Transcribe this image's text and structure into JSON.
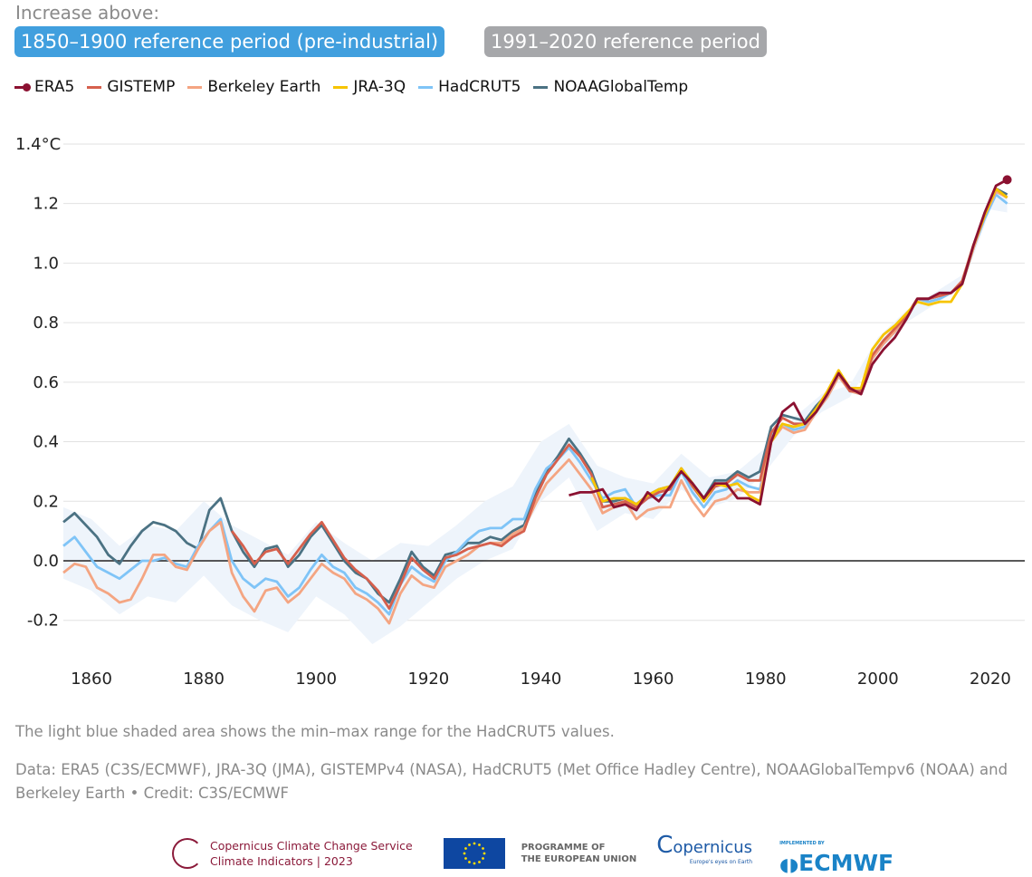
{
  "header": {
    "intro": "Increase above:",
    "reference_buttons": [
      {
        "label": "1850–1900 reference period (pre-industrial)",
        "selected": true,
        "color": "#419fde"
      },
      {
        "label": "1991–2020 reference period",
        "selected": false,
        "color": "#a6a7aa"
      }
    ]
  },
  "legend": [
    {
      "name": "ERA5",
      "color": "#8b1131"
    },
    {
      "name": "GISTEMP",
      "color": "#d6604d"
    },
    {
      "name": "Berkeley Earth",
      "color": "#f4a582"
    },
    {
      "name": "JRA-3Q",
      "color": "#f7c400"
    },
    {
      "name": "HadCRUT5",
      "color": "#7fc4f7"
    },
    {
      "name": "NOAAGlobalTemp",
      "color": "#4b7283"
    }
  ],
  "chart_data": {
    "type": "line",
    "title": "",
    "xlabel": "",
    "ylabel": "",
    "y_unit": "°C",
    "xlim": [
      1855,
      2024
    ],
    "ylim": [
      -0.3,
      1.45
    ],
    "yticks": [
      -0.2,
      0.0,
      0.2,
      0.4,
      0.6,
      0.8,
      1.0,
      1.2,
      1.4
    ],
    "ytick_labels": [
      "-0.2",
      "0.0",
      "0.2",
      "0.4",
      "0.6",
      "0.8",
      "1.0",
      "1.2",
      "1.4°C"
    ],
    "xticks": [
      1860,
      1880,
      1900,
      1920,
      1940,
      1960,
      1980,
      2000,
      2020
    ],
    "xtick_labels": [
      "1860",
      "1880",
      "1900",
      "1920",
      "1940",
      "1960",
      "1980",
      "2000",
      "2020"
    ],
    "grid": "horizontal",
    "zero_line": true,
    "x": [
      1855,
      1857,
      1859,
      1861,
      1863,
      1865,
      1867,
      1869,
      1871,
      1873,
      1875,
      1877,
      1879,
      1881,
      1883,
      1885,
      1887,
      1889,
      1891,
      1893,
      1895,
      1897,
      1899,
      1901,
      1903,
      1905,
      1907,
      1909,
      1911,
      1913,
      1915,
      1917,
      1919,
      1921,
      1923,
      1925,
      1927,
      1929,
      1931,
      1933,
      1935,
      1937,
      1939,
      1941,
      1943,
      1945,
      1947,
      1949,
      1951,
      1953,
      1955,
      1957,
      1959,
      1961,
      1963,
      1965,
      1967,
      1969,
      1971,
      1973,
      1975,
      1977,
      1979,
      1981,
      1983,
      1985,
      1987,
      1989,
      1991,
      1993,
      1995,
      1997,
      1999,
      2001,
      2003,
      2005,
      2007,
      2009,
      2011,
      2013,
      2015,
      2017,
      2019,
      2021,
      2023
    ],
    "series": [
      {
        "name": "NOAAGlobalTemp",
        "color": "#4b7283",
        "values": [
          0.13,
          0.16,
          0.12,
          0.08,
          0.02,
          -0.01,
          0.05,
          0.1,
          0.13,
          0.12,
          0.1,
          0.06,
          0.04,
          0.17,
          0.21,
          0.1,
          0.03,
          -0.02,
          0.04,
          0.05,
          -0.02,
          0.02,
          0.08,
          0.12,
          0.06,
          0.0,
          -0.04,
          -0.06,
          -0.11,
          -0.14,
          -0.06,
          0.03,
          -0.02,
          -0.05,
          0.02,
          0.03,
          0.06,
          0.06,
          0.08,
          0.07,
          0.1,
          0.12,
          0.22,
          0.3,
          0.35,
          0.41,
          0.36,
          0.3,
          0.2,
          0.2,
          0.21,
          0.19,
          0.22,
          0.24,
          0.25,
          0.31,
          0.26,
          0.21,
          0.27,
          0.27,
          0.3,
          0.28,
          0.3,
          0.45,
          0.49,
          0.48,
          0.47,
          0.52,
          0.56,
          0.63,
          0.57,
          0.57,
          0.68,
          0.73,
          0.77,
          0.82,
          0.88,
          0.88,
          0.89,
          0.9,
          0.93,
          1.05,
          1.16,
          1.25,
          1.23
        ]
      },
      {
        "name": "HadCRUT5",
        "color": "#7fc4f7",
        "values": [
          0.05,
          0.08,
          0.03,
          -0.02,
          -0.04,
          -0.06,
          -0.03,
          0.0,
          0.0,
          0.01,
          -0.01,
          -0.02,
          0.05,
          0.1,
          0.14,
          0.0,
          -0.06,
          -0.09,
          -0.06,
          -0.07,
          -0.12,
          -0.09,
          -0.03,
          0.02,
          -0.02,
          -0.04,
          -0.09,
          -0.11,
          -0.14,
          -0.18,
          -0.08,
          -0.02,
          -0.05,
          -0.07,
          0.0,
          0.03,
          0.07,
          0.1,
          0.11,
          0.11,
          0.14,
          0.14,
          0.24,
          0.31,
          0.34,
          0.38,
          0.33,
          0.27,
          0.21,
          0.23,
          0.24,
          0.18,
          0.21,
          0.22,
          0.22,
          0.3,
          0.23,
          0.18,
          0.23,
          0.24,
          0.27,
          0.25,
          0.24,
          0.42,
          0.46,
          0.44,
          0.45,
          0.5,
          0.55,
          0.62,
          0.57,
          0.56,
          0.68,
          0.73,
          0.77,
          0.82,
          0.88,
          0.87,
          0.88,
          0.9,
          0.93,
          1.05,
          1.15,
          1.23,
          1.2
        ]
      },
      {
        "name": "Berkeley Earth",
        "color": "#f4a582",
        "values": [
          -0.04,
          -0.01,
          -0.02,
          -0.09,
          -0.11,
          -0.14,
          -0.13,
          -0.06,
          0.02,
          0.02,
          -0.02,
          -0.03,
          0.04,
          0.1,
          0.13,
          -0.04,
          -0.12,
          -0.17,
          -0.1,
          -0.09,
          -0.14,
          -0.11,
          -0.06,
          -0.01,
          -0.04,
          -0.06,
          -0.11,
          -0.13,
          -0.16,
          -0.21,
          -0.11,
          -0.05,
          -0.08,
          -0.09,
          -0.02,
          0.0,
          0.02,
          0.05,
          0.06,
          0.06,
          0.09,
          0.11,
          0.19,
          0.26,
          0.3,
          0.34,
          0.29,
          0.24,
          0.16,
          0.18,
          0.2,
          0.14,
          0.17,
          0.18,
          0.18,
          0.27,
          0.2,
          0.15,
          0.2,
          0.21,
          0.24,
          0.23,
          0.23,
          0.4,
          0.45,
          0.43,
          0.44,
          0.5,
          0.55,
          0.62,
          0.57,
          0.56,
          0.68,
          0.73,
          0.77,
          0.82,
          0.88,
          0.88,
          0.89,
          0.9,
          0.93,
          1.05,
          1.16,
          1.24,
          1.22
        ]
      },
      {
        "name": "GISTEMP",
        "color": "#d6604d",
        "values": [
          null,
          null,
          null,
          null,
          null,
          null,
          null,
          null,
          null,
          null,
          null,
          null,
          null,
          null,
          null,
          0.1,
          0.05,
          -0.01,
          0.03,
          0.04,
          -0.01,
          0.04,
          0.09,
          0.13,
          0.07,
          0.01,
          -0.03,
          -0.06,
          -0.1,
          -0.16,
          -0.08,
          0.01,
          -0.03,
          -0.06,
          0.01,
          0.02,
          0.04,
          0.05,
          0.06,
          0.05,
          0.08,
          0.1,
          0.21,
          0.29,
          0.34,
          0.39,
          0.35,
          0.29,
          0.18,
          0.19,
          0.2,
          0.18,
          0.21,
          0.23,
          0.24,
          0.31,
          0.25,
          0.2,
          0.25,
          0.26,
          0.29,
          0.27,
          0.27,
          0.43,
          0.48,
          0.46,
          0.46,
          0.51,
          0.56,
          0.63,
          0.57,
          0.57,
          0.69,
          0.74,
          0.78,
          0.82,
          0.88,
          0.88,
          0.89,
          0.9,
          0.94,
          1.06,
          1.16,
          1.25,
          1.22
        ]
      },
      {
        "name": "JRA-3Q",
        "color": "#f7c400",
        "values": [
          null,
          null,
          null,
          null,
          null,
          null,
          null,
          null,
          null,
          null,
          null,
          null,
          null,
          null,
          null,
          null,
          null,
          null,
          null,
          null,
          null,
          null,
          null,
          null,
          null,
          null,
          null,
          null,
          null,
          null,
          null,
          null,
          null,
          null,
          null,
          null,
          null,
          null,
          null,
          null,
          null,
          null,
          null,
          null,
          null,
          null,
          null,
          0.28,
          0.2,
          0.21,
          0.21,
          0.19,
          0.22,
          0.24,
          0.25,
          0.31,
          0.26,
          0.2,
          0.26,
          0.25,
          0.26,
          0.22,
          0.2,
          0.4,
          0.46,
          0.45,
          0.46,
          0.51,
          0.57,
          0.64,
          0.58,
          0.58,
          0.71,
          0.76,
          0.79,
          0.83,
          0.87,
          0.86,
          0.87,
          0.87,
          0.93,
          1.06,
          1.16,
          1.25,
          1.22
        ]
      },
      {
        "name": "ERA5",
        "color": "#8b1131",
        "marker_last": true,
        "values": [
          null,
          null,
          null,
          null,
          null,
          null,
          null,
          null,
          null,
          null,
          null,
          null,
          null,
          null,
          null,
          null,
          null,
          null,
          null,
          null,
          null,
          null,
          null,
          null,
          null,
          null,
          null,
          null,
          null,
          null,
          null,
          null,
          null,
          null,
          null,
          null,
          null,
          null,
          null,
          null,
          null,
          null,
          null,
          null,
          null,
          0.22,
          0.23,
          0.23,
          0.24,
          0.18,
          0.19,
          0.17,
          0.23,
          0.2,
          0.25,
          0.3,
          0.26,
          0.21,
          0.26,
          0.26,
          0.21,
          0.21,
          0.19,
          0.4,
          0.5,
          0.53,
          0.46,
          0.5,
          0.56,
          0.63,
          0.58,
          0.56,
          0.66,
          0.71,
          0.75,
          0.81,
          0.88,
          0.88,
          0.9,
          0.9,
          0.93,
          1.06,
          1.17,
          1.26,
          1.28
        ]
      }
    ],
    "hadcrut5_range": {
      "color": "#eef4fb",
      "x": [
        1855,
        1860,
        1865,
        1870,
        1875,
        1880,
        1885,
        1890,
        1895,
        1900,
        1905,
        1910,
        1915,
        1920,
        1925,
        1930,
        1935,
        1940,
        1945,
        1950,
        1955,
        1960,
        1965,
        1970,
        1975,
        1980,
        1985,
        1990,
        1995,
        2000,
        2005,
        2010,
        2015,
        2020,
        2023
      ],
      "min": [
        -0.06,
        -0.1,
        -0.18,
        -0.12,
        -0.14,
        -0.05,
        -0.15,
        -0.2,
        -0.24,
        -0.12,
        -0.18,
        -0.28,
        -0.22,
        -0.14,
        -0.06,
        0.0,
        0.04,
        0.2,
        0.28,
        0.1,
        0.16,
        0.14,
        0.24,
        0.18,
        0.21,
        0.3,
        0.42,
        0.5,
        0.55,
        0.7,
        0.8,
        0.86,
        0.92,
        1.18,
        1.17
      ],
      "max": [
        0.18,
        0.14,
        0.05,
        0.12,
        0.1,
        0.2,
        0.12,
        0.07,
        0.02,
        0.13,
        0.06,
        0.0,
        0.06,
        0.05,
        0.12,
        0.2,
        0.25,
        0.4,
        0.46,
        0.32,
        0.28,
        0.26,
        0.36,
        0.28,
        0.3,
        0.38,
        0.48,
        0.56,
        0.59,
        0.75,
        0.84,
        0.9,
        0.96,
        1.22,
        1.22
      ]
    }
  },
  "notes": {
    "shading": "The light blue shaded area shows the min–max range for the HadCRUT5 values.",
    "credits": "Data: ERA5 (C3S/ECMWF), JRA-3Q (JMA), GISTEMPv4 (NASA), HadCRUT5 (Met Office Hadley Centre), NOAAGlobalTempv6 (NOAA) and Berkeley Earth • Credit: C3S/ECMWF"
  },
  "logos": {
    "c3s_line1": "Copernicus Climate Change Service",
    "c3s_line2": "Climate Indicators | 2023",
    "eu_line1": "PROGRAMME OF",
    "eu_line2": "THE EUROPEAN UNION",
    "copernicus": "opernicus",
    "copernicus_tag": "Europe's eyes on Earth",
    "ecmwf_tag": "IMPLEMENTED BY",
    "ecmwf": "ECMWF"
  }
}
